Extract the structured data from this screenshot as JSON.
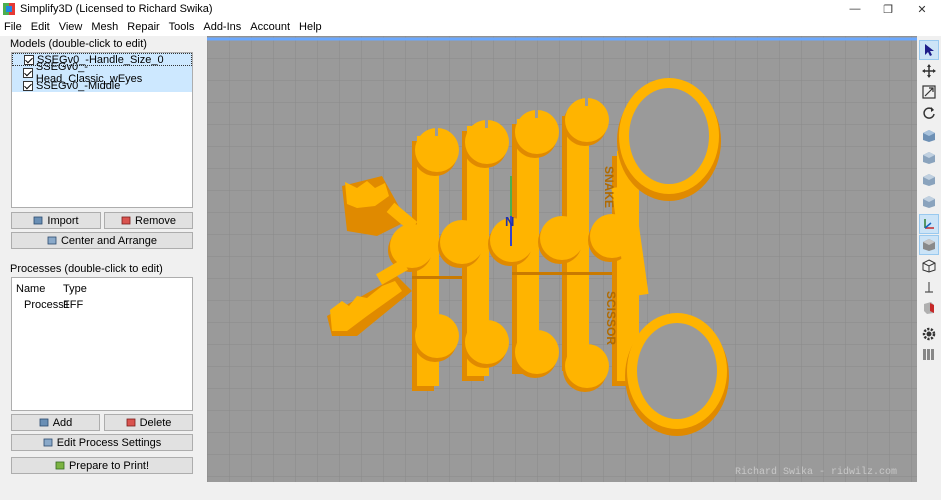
{
  "window": {
    "title": "Simplify3D (Licensed to Richard Swika)",
    "controls": {
      "minimize": "—",
      "maximize": "❐",
      "close": "✕"
    }
  },
  "menu": [
    "File",
    "Edit",
    "View",
    "Mesh",
    "Repair",
    "Tools",
    "Add-Ins",
    "Account",
    "Help"
  ],
  "models": {
    "label": "Models (double-click to edit)",
    "items": [
      {
        "name": "SSEGv0_-Handle_Size_0",
        "checked": true
      },
      {
        "name": "SSEGv0_-Head_Classic_wEyes",
        "checked": true
      },
      {
        "name": "SSEGv0_-Middle",
        "checked": true
      }
    ],
    "import_label": "Import",
    "remove_label": "Remove",
    "center_label": "Center and Arrange"
  },
  "processes": {
    "label": "Processes (double-click to edit)",
    "columns": [
      "Name",
      "Type"
    ],
    "rows": [
      {
        "name": "Process1",
        "type": "FFF"
      }
    ],
    "add_label": "Add",
    "delete_label": "Delete",
    "edit_label": "Edit Process Settings",
    "prepare_label": "Prepare to Print!"
  },
  "viewport": {
    "watermark": "Richard Swika - ridwilz.com",
    "text_snake": "SNAKE",
    "text_scissor": "SCISSOR",
    "axis_label": "N",
    "colors": {
      "part": "#ffb400",
      "part_dark": "#e08a00",
      "bed": "#9a9a9a",
      "grid": "#8a8a8a"
    }
  },
  "toolbar": {
    "icons": [
      "select-icon",
      "move-icon",
      "scale-icon",
      "rotate-icon",
      "view-iso-icon",
      "view-front-icon",
      "view-top-icon",
      "view-side-icon",
      "axis-icon",
      "solid-cube-icon",
      "wireframe-cube-icon",
      "z-arrow-icon",
      "cross-section-icon",
      "gear-icon",
      "bars-icon"
    ]
  }
}
